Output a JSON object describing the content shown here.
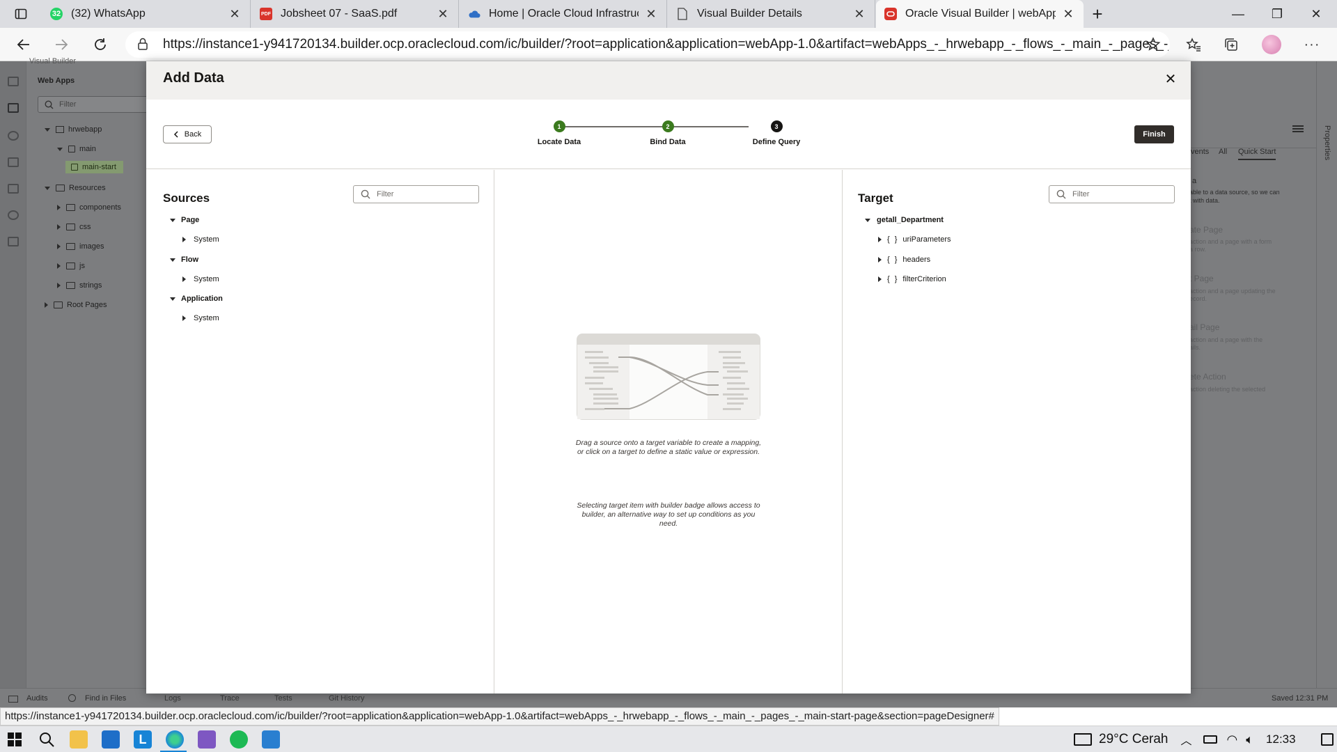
{
  "browser": {
    "tabs": [
      {
        "label": "(32) WhatsApp",
        "badge": "32"
      },
      {
        "label": "Jobsheet 07 - SaaS.pdf"
      },
      {
        "label": "Home | Oracle Cloud Infrastructu"
      },
      {
        "label": "Visual Builder Details"
      },
      {
        "label": "Oracle Visual Builder | webApp-1"
      }
    ],
    "url": "https://instance1-y941720134.builder.ocp.oraclecloud.com/ic/builder/?root=application&application=webApp-1.0&artifact=webApps_-_hrwebapp_-_flows_-_main_-_pages_-_mai...",
    "status_url": "https://instance1-y941720134.builder.ocp.oraclecloud.com/ic/builder/?root=application&application=webApp-1.0&artifact=webApps_-_hrwebapp_-_flows_-_main_-_pages_-_main-start-page&section=pageDesigner#"
  },
  "ide": {
    "brand": "Visual Builder",
    "nav_header": "Web Apps",
    "nav_filter_placeholder": "Filter",
    "tree": [
      "hrwebapp",
      "main",
      "main-start",
      "Resources",
      "components",
      "css",
      "images",
      "js",
      "strings",
      "Root Pages"
    ],
    "right_tabs": [
      "vents",
      "All",
      "Quick Start"
    ],
    "right_text": [
      "a",
      "able to a data source, so we can",
      "t with data.",
      "ate Page",
      "action and a page with a form",
      "a row.",
      "t Page",
      "action and a page updating the",
      "ecord.",
      "ail Page",
      "action and a page with the",
      "ails.",
      "ete Action",
      "action deleting the selected"
    ],
    "properties_label": "Properties",
    "bottom_tabs": [
      "Audits",
      "Find in Files",
      "Logs",
      "Trace",
      "Tests",
      "Git History"
    ],
    "saved": "Saved 12:31 PM"
  },
  "modal": {
    "title": "Add Data",
    "back_label": "Back",
    "finish_label": "Finish",
    "steps": [
      {
        "num": "1",
        "label": "Locate Data",
        "state": "done"
      },
      {
        "num": "2",
        "label": "Bind Data",
        "state": "done"
      },
      {
        "num": "3",
        "label": "Define Query",
        "state": "current"
      }
    ],
    "sources": {
      "title": "Sources",
      "filter_placeholder": "Filter",
      "items": [
        {
          "label": "Page",
          "child": "System"
        },
        {
          "label": "Flow",
          "child": "System"
        },
        {
          "label": "Application",
          "child": "System"
        }
      ]
    },
    "mapping_hint": "Drag a source onto a target variable to create a mapping,",
    "mapping_hint2": "or click on a target to define a static value or expression.",
    "builder_hint": "Selecting target item with builder badge allows access to",
    "builder_hint2": "builder, an alternative way to set up conditions as you",
    "builder_hint3": "need.",
    "target": {
      "title": "Target",
      "filter_placeholder": "Filter",
      "root": "getall_Department",
      "children": [
        "uriParameters",
        "headers",
        "filterCriterion"
      ]
    }
  },
  "taskbar": {
    "weather": "29°C Cerah",
    "time": "12:33"
  },
  "colors": {
    "step_done": "#3b7a1e",
    "step_current": "#161513",
    "finish_bg": "#312d2a"
  }
}
